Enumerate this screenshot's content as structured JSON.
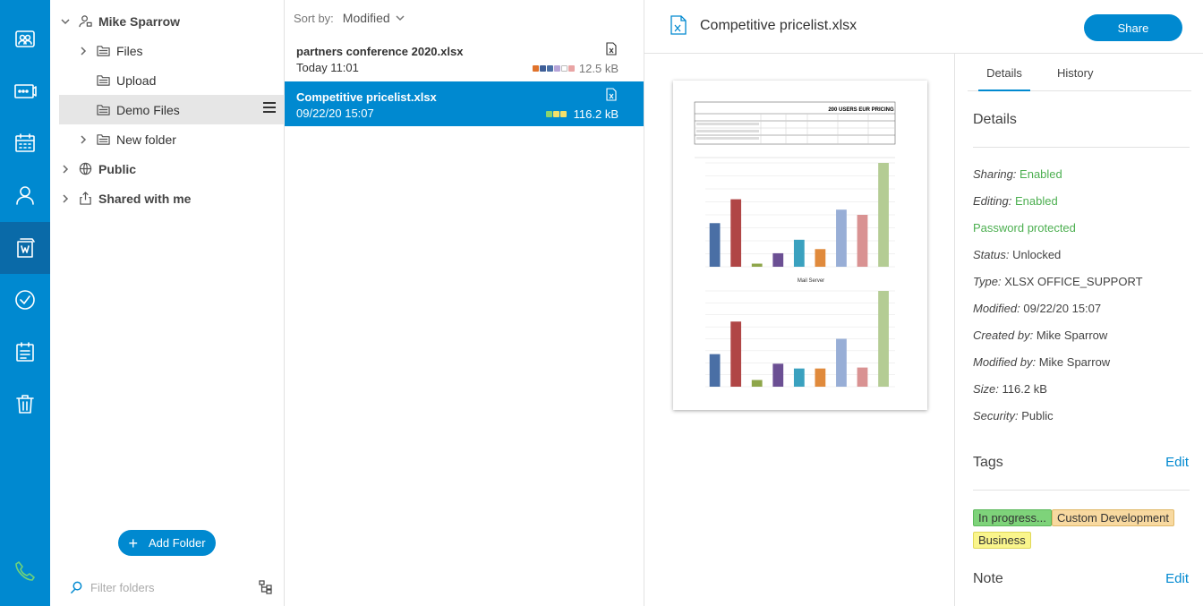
{
  "tree": {
    "root": "Mike Sparrow",
    "items": [
      {
        "label": "Files"
      },
      {
        "label": "Upload"
      },
      {
        "label": "Demo Files"
      },
      {
        "label": "New folder"
      }
    ],
    "public": "Public",
    "shared": "Shared with me",
    "add_folder": "Add Folder",
    "filter_placeholder": "Filter folders"
  },
  "list": {
    "sort_label": "Sort by:",
    "sort_value": "Modified",
    "files": [
      {
        "name": "partners conference 2020.xlsx",
        "date": "Today 11:01",
        "size": "12.5 kB",
        "dots": [
          "#e0732c",
          "#3e5e97",
          "#4a6fa5",
          "#b7a5d8",
          "#ffffff",
          "#e9a4a4"
        ]
      },
      {
        "name": "Competitive pricelist.xlsx",
        "date": "09/22/20 15:07",
        "size": "116.2 kB",
        "dots": [
          "#8bd36e",
          "#f5e06a",
          "#f5e06a"
        ]
      }
    ]
  },
  "detail": {
    "title": "Competitive pricelist.xlsx",
    "share": "Share",
    "tabs": [
      "Details",
      "History"
    ],
    "details_title": "Details",
    "props": [
      {
        "key": "Sharing:",
        "value": "Enabled",
        "green": true
      },
      {
        "key": "Editing:",
        "value": "Enabled",
        "green": true
      },
      {
        "key": "",
        "value": "Password protected",
        "green": true
      },
      {
        "key": "Status:",
        "value": "Unlocked"
      },
      {
        "key": "Type:",
        "value": "XLSX OFFICE_SUPPORT"
      },
      {
        "key": "Modified:",
        "value": "09/22/20 15:07"
      },
      {
        "key": "Created by:",
        "value": "Mike Sparrow"
      },
      {
        "key": "Modified by:",
        "value": "Mike Sparrow"
      },
      {
        "key": "Size:",
        "value": "116.2 kB"
      },
      {
        "key": "Security:",
        "value": "Public"
      }
    ],
    "tags_title": "Tags",
    "edit": "Edit",
    "tags": [
      {
        "label": "In progress...",
        "bg": "#7ed37a",
        "border": "#5cb85c"
      },
      {
        "label": "Custom Development",
        "bg": "#f8d9a0",
        "border": "#e0b868"
      },
      {
        "label": "Business",
        "bg": "#faf58c",
        "border": "#e0d85a"
      }
    ],
    "note_title": "Note",
    "preview": {
      "sheet_title": "200 USERS EUR PRICING",
      "chart2_title": "Mail Server",
      "bars1": [
        0.42,
        0.65,
        0.03,
        0.13,
        0.26,
        0.17,
        0.55,
        0.5,
        1.0
      ],
      "bars2": [
        0.34,
        0.68,
        0.07,
        0.24,
        0.19,
        0.19,
        0.5,
        0.2,
        1.0
      ],
      "bar_colors": [
        "#4a6fa5",
        "#b04646",
        "#8ea64a",
        "#6b4f93",
        "#3aa1bf",
        "#e08a3c",
        "#98aed6",
        "#d99292",
        "#b4cc94"
      ]
    }
  }
}
